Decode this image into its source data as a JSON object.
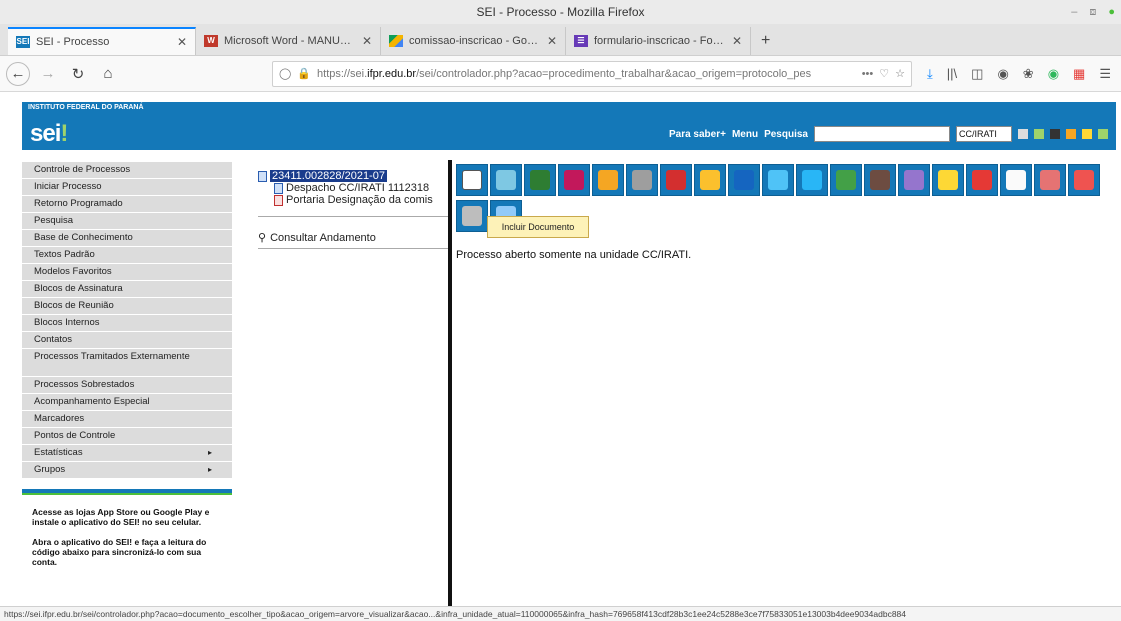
{
  "window": {
    "title": "SEI - Processo - Mozilla Firefox"
  },
  "tabs": [
    {
      "label": "SEI - Processo",
      "icon": "sei-favicon",
      "color": "#1478b8"
    },
    {
      "label": "Microsoft Word - MANUAL - C",
      "icon": "word-favicon",
      "color": "#c0392b"
    },
    {
      "label": "comissao-inscricao - Google",
      "icon": "drive-favicon",
      "color": "#f4b400"
    },
    {
      "label": "formulario-inscricao - Formu",
      "icon": "forms-favicon",
      "color": "#673ab7"
    }
  ],
  "urlbar": {
    "prefix": "https://sei.",
    "host": "ifpr.edu.br",
    "path": "/sei/controlador.php?acao=procedimento_trabalhar&acao_origem=protocolo_pes",
    "more": "•••"
  },
  "sei": {
    "institution": "INSTITUTO FEDERAL DO PARANÁ",
    "logo": "sei",
    "logo_accent": "!",
    "nav_para_saber": "Para saber+",
    "nav_menu": "Menu",
    "nav_pesquisa": "Pesquisa",
    "unit_select": "CC/IRATI"
  },
  "menu": {
    "items": [
      {
        "label": "Controle de Processos"
      },
      {
        "label": "Iniciar Processo"
      },
      {
        "label": "Retorno Programado"
      },
      {
        "label": "Pesquisa"
      },
      {
        "label": "Base de Conhecimento"
      },
      {
        "label": "Textos Padrão"
      },
      {
        "label": "Modelos Favoritos"
      },
      {
        "label": "Blocos de Assinatura"
      },
      {
        "label": "Blocos de Reunião"
      },
      {
        "label": "Blocos Internos"
      },
      {
        "label": "Contatos"
      },
      {
        "label": "Processos Tramitados Externamente"
      },
      {
        "label": "Processos Sobrestados"
      },
      {
        "label": "Acompanhamento Especial"
      },
      {
        "label": "Marcadores"
      },
      {
        "label": "Pontos de Controle"
      },
      {
        "label": "Estatísticas",
        "submenu": "▸"
      },
      {
        "label": "Grupos",
        "submenu": "▸"
      }
    ],
    "promo_1": "Acesse as lojas App Store ou Google Play e instale o aplicativo do SEI! no seu celular.",
    "promo_2": "Abra o aplicativo do SEI! e faça a leitura do código abaixo para sincronizá-lo com sua conta."
  },
  "tree": {
    "process_number": "23411.002828/2021-07",
    "documents": [
      {
        "label": "Despacho CC/IRATI 1112318",
        "type": "doc"
      },
      {
        "label": "Portaria Designação da comis",
        "type": "pdf"
      }
    ],
    "andamento": "Consultar Andamento"
  },
  "toolbar": {
    "tooltip": "Incluir Documento",
    "button_colors": [
      "#ffffff",
      "#7ec8e3",
      "#2e7d32",
      "#c2185b",
      "#f5a623",
      "#9e9e9e",
      "#d32f2f",
      "#fbc02d",
      "#1565c0",
      "#4fc3f7",
      "#29b6f6",
      "#43a047",
      "#6d4c41",
      "#9575cd",
      "#fdd835",
      "#e53935",
      "#fafafa",
      "#e57373",
      "#ef5350",
      "#bdbdbd",
      "#90caf9"
    ]
  },
  "status": {
    "message": "Processo aberto somente na unidade CC/IRATI."
  },
  "statusbar": {
    "text": "https://sei.ifpr.edu.br/sei/controlador.php?acao=documento_escolher_tipo&acao_origem=arvore_visualizar&acao...&infra_unidade_atual=110000065&infra_hash=769658f413cdf28b3c1ee24c5288e3ce7f75833051e13003b4dee9034adbc884"
  }
}
